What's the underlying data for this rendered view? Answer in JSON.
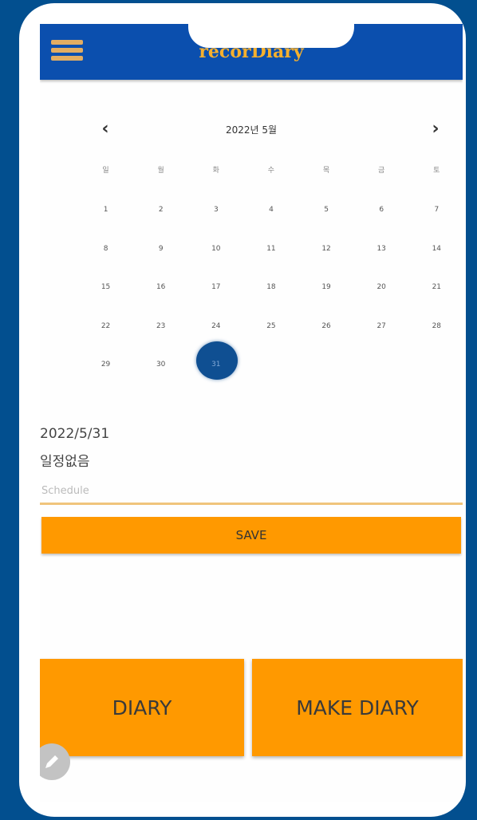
{
  "app": {
    "title": "recorDiary"
  },
  "calendar": {
    "month_title": "2022년 5월",
    "prev_label": "‹",
    "next_label": "›",
    "weekdays": [
      "일",
      "월",
      "화",
      "수",
      "목",
      "금",
      "토"
    ],
    "weeks": [
      [
        "1",
        "2",
        "3",
        "4",
        "5",
        "6",
        "7"
      ],
      [
        "8",
        "9",
        "10",
        "11",
        "12",
        "13",
        "14"
      ],
      [
        "15",
        "16",
        "17",
        "18",
        "19",
        "20",
        "21"
      ],
      [
        "22",
        "23",
        "24",
        "25",
        "26",
        "27",
        "28"
      ],
      [
        "29",
        "30",
        "31"
      ]
    ],
    "selected_day": "31"
  },
  "schedule": {
    "date": "2022/5/31",
    "status": "일정없음",
    "placeholder": "Schedule",
    "value": "",
    "save_label": "SAVE"
  },
  "actions": {
    "diary_label": "DIARY",
    "make_diary_label": "MAKE DIARY"
  },
  "colors": {
    "background": "#024f8f",
    "appbar": "#0b4fae",
    "title": "#f6b02e",
    "accent": "#ff9900",
    "selected_day": "#0f4f92"
  },
  "icons": {
    "menu": "hamburger-menu-icon",
    "prev": "chevron-left-icon",
    "next": "chevron-right-icon",
    "edit": "pencil-icon"
  }
}
